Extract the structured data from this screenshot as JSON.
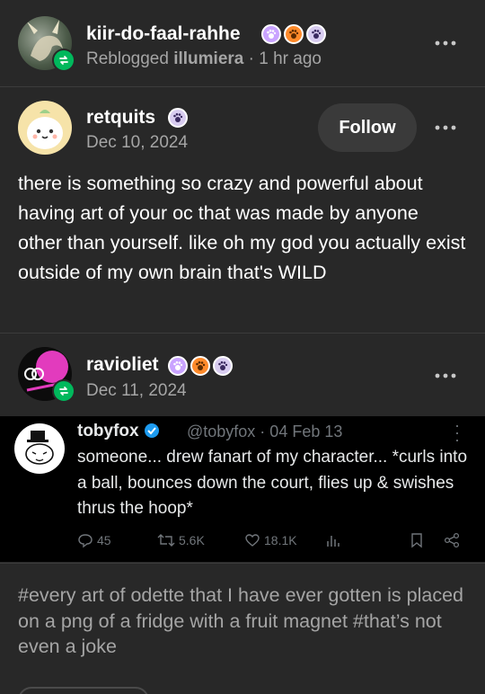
{
  "reblogger": {
    "name": "kiir-do-faal-rahhe",
    "reblogged_prefix": "Reblogged",
    "reblogged_from": "illumiera",
    "time": "· 1 hr ago"
  },
  "original": {
    "name": "retquits",
    "date": "Dec 10, 2024",
    "follow_label": "Follow",
    "text": "there is something so crazy and powerful about having art of your oc that was made by anyone other than yourself. like oh my god you actually exist outside of my own brain that's WILD"
  },
  "reply": {
    "name": "ravioliet",
    "date": "Dec 11, 2024"
  },
  "tweet": {
    "name": "tobyfox",
    "handle": "@tobyfox · 04 Feb 13",
    "text": "someone... drew fanart of my character... *curls into a ball, bounces down the court, flies up & swishes thrus the hoop*",
    "replies": "45",
    "retweets": "5.6K",
    "likes": "18.1K"
  },
  "tags": "#every art of odette that I have ever gotten is placed on a png of a fridge with a fruit magnet #that’s not even a joke",
  "colors": {
    "background": "#282828",
    "reblog_green": "#00b85c",
    "verified_blue": "#1d9bf0",
    "badge_purple": "#c9a3ff",
    "badge_orange": "#ff8a2a"
  },
  "icons": [
    "reblog-icon",
    "more-icon",
    "paw-badge-icon",
    "verified-icon",
    "reply-icon",
    "retweet-icon",
    "like-icon",
    "views-icon",
    "bookmark-icon",
    "share-icon"
  ]
}
